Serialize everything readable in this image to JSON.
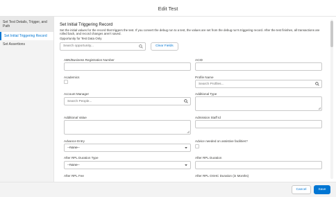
{
  "modal": {
    "title": "Edit Test"
  },
  "sidebar": {
    "items": [
      {
        "label": "Set Test Details, Trigger, and Path"
      },
      {
        "label": "Set Initial Triggering Record"
      },
      {
        "label": "Set Assertions"
      }
    ]
  },
  "section": {
    "title": "Set Initial Triggering Record",
    "description": "Set the initial values for the record that triggers the test. If you convert the debug run to a test, the values are set from the debug run's triggering record. After the test finishes, all transactions are rolled back, and record changes aren't saved.",
    "opportunity_label": "Opportunity for Test Data Only",
    "opportunity_placeholder": "Search opportunity...",
    "clear_fields": "Clear Fields"
  },
  "fields": {
    "abn": {
      "label": "ABN/Business Registration Number"
    },
    "acid": {
      "label": "ACID"
    },
    "academics": {
      "label": "Academics"
    },
    "profile_name": {
      "label": "Profile Name",
      "placeholder": "Search Profiles..."
    },
    "account_manager": {
      "label": "Account Manager",
      "placeholder": "Search People..."
    },
    "additional_type": {
      "label": "Additional Type"
    },
    "additional_value": {
      "label": "Additional Value"
    },
    "admission_staff_id": {
      "label": "Admission Staff Id"
    },
    "advance_entry": {
      "label": "Advance Entry",
      "value": "--None--"
    },
    "advice_needed": {
      "label": "Advice needed on assistive facilities?"
    },
    "after_rpl_duration_type": {
      "label": "After RPL Duration Type",
      "value": "--None--"
    },
    "after_rpl_duration": {
      "label": "After RPL Duration"
    },
    "after_rpl_fee": {
      "label": "After RPL Fee"
    },
    "after_rpl_oshc": {
      "label": "After RPL OSHC Duration (in Months)"
    }
  },
  "footer": {
    "cancel": "Cancel",
    "save": "Save"
  },
  "colors": {
    "accent": "#0176d3",
    "border": "#c9c9c9",
    "sidebar_bg": "#f3f3f3"
  }
}
